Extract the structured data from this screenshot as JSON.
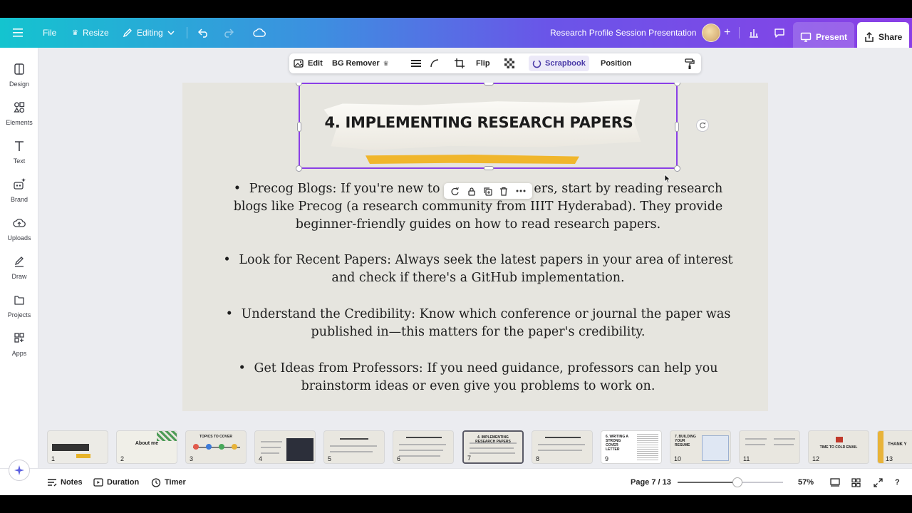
{
  "topbar": {
    "file_label": "File",
    "resize_label": "Resize",
    "editing_label": "Editing",
    "doc_title": "Research Profile Session Presentation",
    "present_label": "Present",
    "share_label": "Share"
  },
  "sidebar": {
    "items": [
      {
        "label": "Design",
        "icon": "design-icon"
      },
      {
        "label": "Elements",
        "icon": "elements-icon"
      },
      {
        "label": "Text",
        "icon": "text-icon"
      },
      {
        "label": "Brand",
        "icon": "brand-icon"
      },
      {
        "label": "Uploads",
        "icon": "uploads-icon"
      },
      {
        "label": "Draw",
        "icon": "draw-icon"
      },
      {
        "label": "Projects",
        "icon": "projects-icon"
      },
      {
        "label": "Apps",
        "icon": "apps-icon"
      }
    ]
  },
  "context_toolbar": {
    "edit_label": "Edit",
    "bg_remover_label": "BG Remover",
    "flip_label": "Flip",
    "scrapbook_label": "Scrapbook",
    "position_label": "Position"
  },
  "slide": {
    "heading": "4. IMPLEMENTING RESEARCH PAPERS",
    "bullets": [
      "Precog Blogs: If you're new to research papers, start by reading research blogs like Precog (a research community from IIIT Hyderabad). They provide beginner-friendly guides on how to read research papers.",
      "Look for Recent Papers: Always seek the latest papers in your area of interest and check if there's a GitHub implementation.",
      "Understand the Credibility: Know which conference or journal the paper was published in—this matters for the paper's credibility.",
      "Get Ideas from Professors: If you need guidance, professors can help you brainstorm ideas or even give you problems to work on."
    ],
    "bullet_lines": [
      [
        "Precog Blogs: If you're new to r",
        "ers, start by reading research",
        "blogs like Precog (a research community from IIIT Hyderabad). They provide",
        "beginner-friendly guides on how to read research papers."
      ],
      [
        "Look for Recent Papers: Always seek the latest papers in your area of interest",
        "and check if there's a GitHub implementation."
      ],
      [
        "Understand the Credibility: Know which conference or journal the paper was",
        "published in—this matters for the paper's credibility."
      ],
      [
        "Get Ideas from Professors: If you need guidance, professors can help you",
        "brainstorm ideas or even give you problems to work on."
      ]
    ]
  },
  "thumbnails": [
    {
      "num": "1",
      "title": ""
    },
    {
      "num": "2",
      "title": "About me"
    },
    {
      "num": "3",
      "title": "TOPICS TO COVER"
    },
    {
      "num": "4",
      "title": ""
    },
    {
      "num": "5",
      "title": ""
    },
    {
      "num": "6",
      "title": ""
    },
    {
      "num": "7",
      "title": "4. IMPLEMENTING RESEARCH PAPERS"
    },
    {
      "num": "8",
      "title": ""
    },
    {
      "num": "9",
      "title": "6. WRITING A STRONG COVER LETTER"
    },
    {
      "num": "10",
      "title": "7. BUILDING YOUR RESUME"
    },
    {
      "num": "11",
      "title": ""
    },
    {
      "num": "12",
      "title": "TIME TO COLD EMAIL"
    },
    {
      "num": "13",
      "title": "THANK Y"
    }
  ],
  "bottombar": {
    "notes_label": "Notes",
    "duration_label": "Duration",
    "timer_label": "Timer",
    "page_indicator": "Page 7 / 13",
    "zoom_label": "57%",
    "zoom_fraction": 0.57
  },
  "colors": {
    "accent_purple": "#8a3fe6",
    "teal": "#14c4cf",
    "tape_yellow": "#f0b62c"
  }
}
